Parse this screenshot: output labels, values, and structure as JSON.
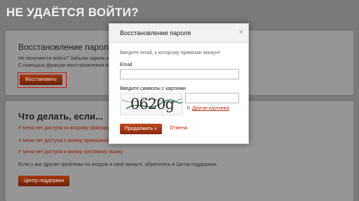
{
  "page": {
    "title": "НЕ УДАЁТСЯ ВОЙТИ?"
  },
  "restore_card": {
    "title": "Восстановление пароля",
    "line1": "Не получается войти? Забыли пароль к а",
    "line2": "С помощью функции восстановления па",
    "button": "Восстановить"
  },
  "help_card": {
    "title": "Что делать, если...",
    "links": [
      "У меня нет доступа ко второму фактору з",
      "У меня нет доступа к моему привязанном",
      "У меня нет доступа к моему почтовому ящику"
    ],
    "note": "Если у вас другие проблемы со входом в свой аккаунт, обратитесь в Центр поддержки.",
    "button": "Центр поддержки"
  },
  "modal": {
    "title": "Восстановление пароля",
    "close": "×",
    "intro": "Введите email, к которому привязан аккаунт",
    "email_label": "Email",
    "email_value": "",
    "captcha_label": "Введите символы с картинки",
    "captcha_value": "",
    "captcha_text": "0620g",
    "refresh_icon": "↻",
    "refresh_label": "Другая картинка",
    "continue_label": "Продолжить »",
    "cancel_label": "Отмена"
  },
  "colors": {
    "accent_red": "#9a1e08",
    "button_red": "#8a2a0e",
    "highlight": "#d2170c"
  }
}
